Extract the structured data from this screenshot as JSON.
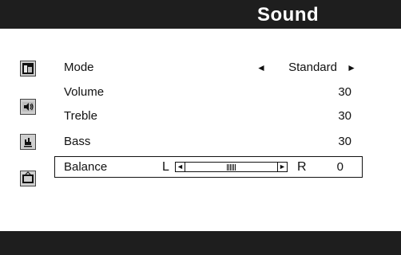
{
  "header": {
    "title": "Sound"
  },
  "sidebar": {
    "icons": [
      "picture-icon",
      "sound-icon",
      "features-icon",
      "channel-icon"
    ]
  },
  "menu": {
    "mode": {
      "label": "Mode",
      "value": "Standard",
      "left_arrow": "◄",
      "right_arrow": "►"
    },
    "volume": {
      "label": "Volume",
      "value": "30"
    },
    "treble": {
      "label": "Treble",
      "value": "30"
    },
    "bass": {
      "label": "Bass",
      "value": "30"
    },
    "balance": {
      "label": "Balance",
      "left_label": "L",
      "right_label": "R",
      "value": "0",
      "position": 0.5,
      "left_arrow": "◄",
      "right_arrow": "►"
    }
  }
}
